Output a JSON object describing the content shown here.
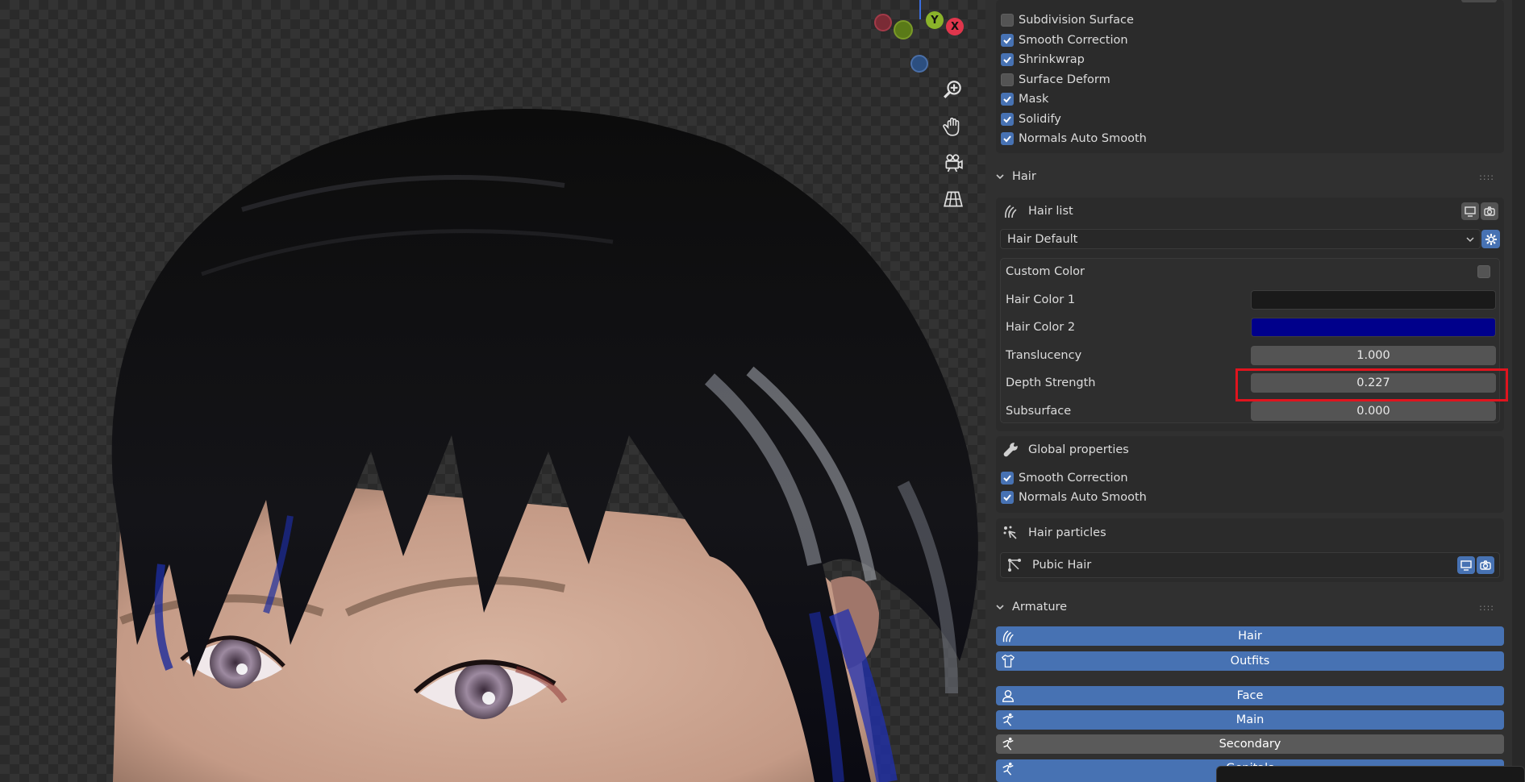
{
  "viewport": {
    "gizmo": {
      "x_label": "X",
      "y_label": "Y"
    }
  },
  "modifiers": {
    "items": [
      {
        "label": "Subdivision Surface",
        "checked": false
      },
      {
        "label": "Smooth Correction",
        "checked": true
      },
      {
        "label": "Shrinkwrap",
        "checked": true
      },
      {
        "label": "Surface Deform",
        "checked": false
      },
      {
        "label": "Mask",
        "checked": true
      },
      {
        "label": "Solidify",
        "checked": true
      },
      {
        "label": "Normals Auto Smooth",
        "checked": true
      }
    ]
  },
  "hair": {
    "section_title": "Hair",
    "list_title": "Hair list",
    "dropdown_value": "Hair Default",
    "custom_color_label": "Custom Color",
    "hair_color_1_label": "Hair Color 1",
    "hair_color_1_value": "#1a1a1a",
    "hair_color_2_label": "Hair Color 2",
    "hair_color_2_value": "#00008b",
    "translucency_label": "Translucency",
    "translucency_value": "1.000",
    "depth_strength_label": "Depth Strength",
    "depth_strength_value": "0.227",
    "subsurface_label": "Subsurface",
    "subsurface_value": "0.000",
    "global_title": "Global properties",
    "global_items": [
      {
        "label": "Smooth Correction",
        "checked": true
      },
      {
        "label": "Normals Auto Smooth",
        "checked": true
      }
    ],
    "particles_title": "Hair particles",
    "particle_item": "Pubic Hair"
  },
  "armature": {
    "section_title": "Armature",
    "buttons": [
      {
        "label": "Hair",
        "active": true
      },
      {
        "label": "Outfits",
        "active": true
      },
      {
        "label": "Face",
        "active": true
      },
      {
        "label": "Main",
        "active": true
      },
      {
        "label": "Secondary",
        "active": false
      },
      {
        "label": "Genitals",
        "active": true
      }
    ]
  },
  "colors": {
    "accent": "#4772b3",
    "highlight_box": "#e0141e"
  }
}
